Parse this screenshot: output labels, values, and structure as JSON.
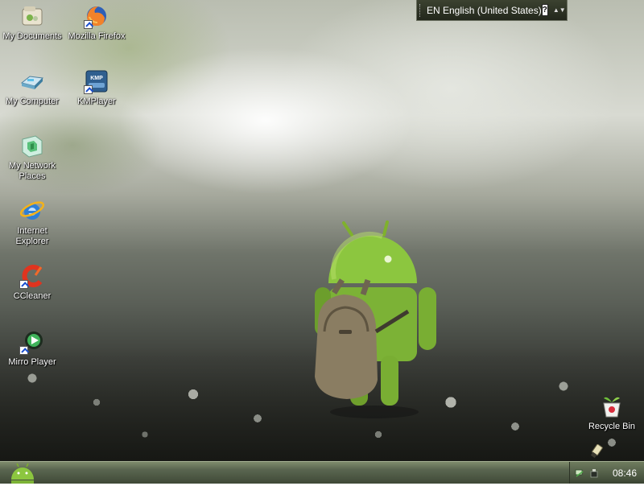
{
  "desktop": {
    "icons_left_column": [
      {
        "label": "My Documents",
        "icon": "my-documents-icon"
      },
      {
        "label": "My Computer",
        "icon": "my-computer-icon"
      },
      {
        "label": "My Network Places",
        "icon": "network-places-icon"
      },
      {
        "label": "Internet Explorer",
        "icon": "internet-explorer-icon"
      },
      {
        "label": "CCleaner",
        "icon": "ccleaner-icon"
      },
      {
        "label": "Mirro Player",
        "icon": "mirro-player-icon"
      }
    ],
    "icons_second_column": [
      {
        "label": "Mozilla Firefox",
        "icon": "firefox-icon"
      },
      {
        "label": "KMPlayer",
        "icon": "kmplayer-icon",
        "badge": "KMP"
      }
    ],
    "recycle_bin": {
      "label": "Recycle Bin",
      "icon": "recycle-bin-icon"
    }
  },
  "language_bar": {
    "text": "EN English (United States)",
    "help_glyph": "?",
    "options_glyph": "▲▼"
  },
  "taskbar": {
    "start_icon": "android-start-icon",
    "clock": "08:46",
    "tray_icons": [
      "network-icon",
      "usb-icon"
    ]
  },
  "colors": {
    "taskbar_green": "#5a6650",
    "android_green": "#8cc63f"
  }
}
